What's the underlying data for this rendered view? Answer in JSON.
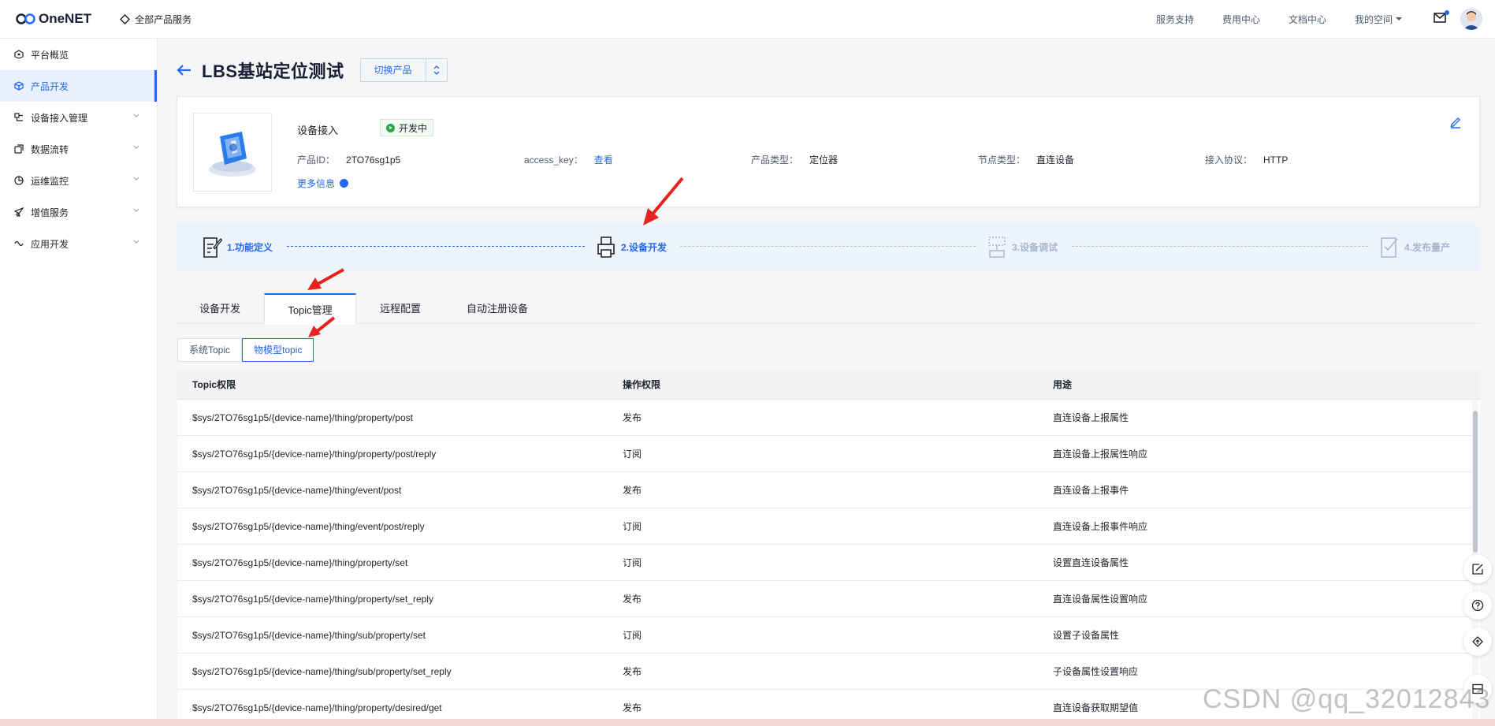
{
  "brand": {
    "name": "OneNET",
    "all_products": "全部产品服务"
  },
  "topnav": {
    "items": [
      "服务支持",
      "费用中心",
      "文档中心"
    ],
    "mine": "我的空间"
  },
  "sidebar": {
    "items": [
      {
        "label": "平台概览"
      },
      {
        "label": "产品开发"
      },
      {
        "label": "设备接入管理"
      },
      {
        "label": "数据流转"
      },
      {
        "label": "运维监控"
      },
      {
        "label": "增值服务"
      },
      {
        "label": "应用开发"
      }
    ]
  },
  "page": {
    "title": "LBS基站定位测试",
    "switch_label": "切换产品"
  },
  "product": {
    "access": "设备接入",
    "status": "开发中",
    "id_label": "产品ID：",
    "id_value": "2TO76sg1p5",
    "key_label": "access_key：",
    "key_value": "查看",
    "type_label": "产品类型：",
    "type_value": "定位器",
    "node_label": "节点类型：",
    "node_value": "直连设备",
    "protocol_label": "接入协议：",
    "protocol_value": "HTTP",
    "more": "更多信息"
  },
  "steps": [
    "1.功能定义",
    "2.设备开发",
    "3.设备调试",
    "4.发布量产"
  ],
  "tabs": [
    "设备开发",
    "Topic管理",
    "远程配置",
    "自动注册设备"
  ],
  "subtabs": [
    "系统Topic",
    "物模型topic"
  ],
  "table": {
    "headers": [
      "Topic权限",
      "操作权限",
      "用途"
    ],
    "rows": [
      [
        "$sys/2TO76sg1p5/{device-name}/thing/property/post",
        "发布",
        "直连设备上报属性"
      ],
      [
        "$sys/2TO76sg1p5/{device-name}/thing/property/post/reply",
        "订阅",
        "直连设备上报属性响应"
      ],
      [
        "$sys/2TO76sg1p5/{device-name}/thing/event/post",
        "发布",
        "直连设备上报事件"
      ],
      [
        "$sys/2TO76sg1p5/{device-name}/thing/event/post/reply",
        "订阅",
        "直连设备上报事件响应"
      ],
      [
        "$sys/2TO76sg1p5/{device-name}/thing/property/set",
        "订阅",
        "设置直连设备属性"
      ],
      [
        "$sys/2TO76sg1p5/{device-name}/thing/property/set_reply",
        "发布",
        "直连设备属性设置响应"
      ],
      [
        "$sys/2TO76sg1p5/{device-name}/thing/sub/property/set",
        "订阅",
        "设置子设备属性"
      ],
      [
        "$sys/2TO76sg1p5/{device-name}/thing/sub/property/set_reply",
        "发布",
        "子设备属性设置响应"
      ],
      [
        "$sys/2TO76sg1p5/{device-name}/thing/property/desired/get",
        "发布",
        "直连设备获取期望值"
      ]
    ]
  },
  "watermark": "CSDN @qq_32012843",
  "colors": {
    "accent": "#2468f2",
    "status": "#2ca84a",
    "annotation": "#e8231f"
  }
}
